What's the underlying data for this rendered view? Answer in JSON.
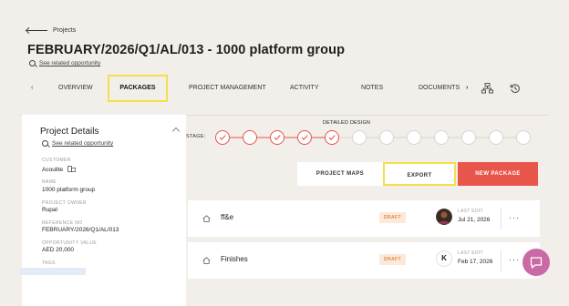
{
  "breadcrumb": {
    "label": "Projects"
  },
  "page": {
    "title": "FEBRUARY/2026/Q1/AL/013 - 1000 platform group",
    "related_link": "See related opportunity"
  },
  "tabs": {
    "prev": "‹",
    "items": [
      "OVERVIEW",
      "PACKAGES",
      "PROJECT MANAGEMENT",
      "ACTIVITY",
      "NOTES",
      "DOCUMENTS"
    ],
    "next": "›",
    "active": "PACKAGES"
  },
  "details": {
    "title": "Project Details",
    "related_link": "See related opportunity",
    "customer_label": "CUSTOMER",
    "customer_value": "Acoulite",
    "name_label": "NAME",
    "name_value": "1000 platform group",
    "owner_label": "PROJECT OWNER",
    "owner_value": "Rupal",
    "ref_label": "REFERENCE NO",
    "ref_value": "FEBRUARY/2026/Q1/AL/013",
    "opp_label": "OPPORTUNITY VALUE",
    "opp_value": "AED 20,000",
    "tags_label": "TAGS"
  },
  "stage": {
    "label": "STAGE:",
    "current_name": "DETAILED DESIGN",
    "steps_total": 12,
    "completed": 5,
    "accent": "#e8554a"
  },
  "actions": {
    "maps": "PROJECT MAPS",
    "export": "EXPORT",
    "new_package": "NEW PACKAGE"
  },
  "packages": [
    {
      "name": "ff&e",
      "status": "DRAFT",
      "last_edit_label": "LAST EDIT",
      "last_edit": "Jul 21, 2026",
      "avatar": "photo",
      "more": "···"
    },
    {
      "name": "Finishes",
      "status": "DRAFT",
      "last_edit_label": "LAST EDIT",
      "last_edit": "Feb 17, 2026",
      "avatar": "K",
      "more": "···"
    }
  ]
}
